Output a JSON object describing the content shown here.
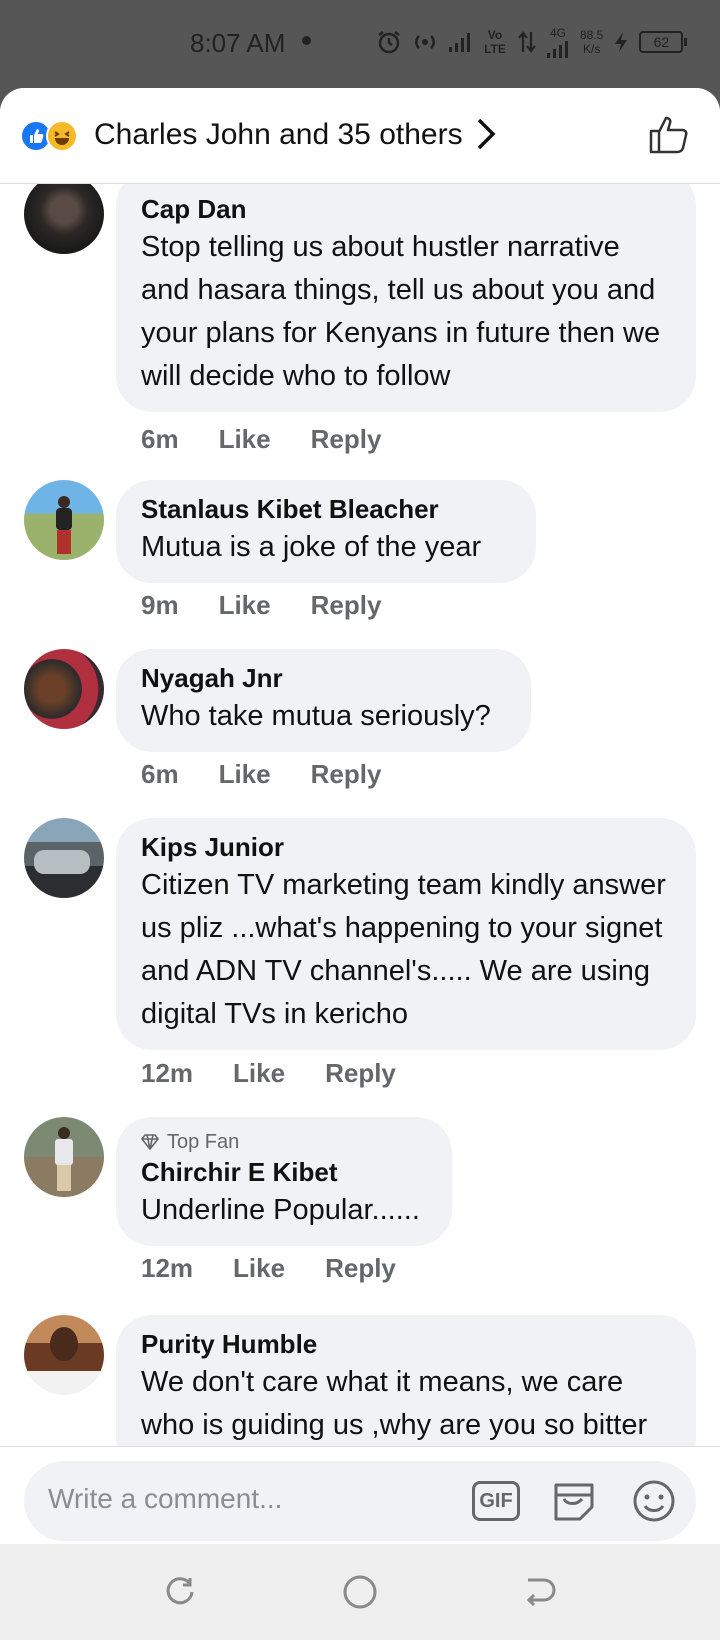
{
  "status": {
    "time": "8:07 AM",
    "speed_value": "88.5",
    "speed_unit": "K/s",
    "net": "4G",
    "volte": "Vo LTE",
    "battery": "62"
  },
  "header": {
    "reactors": "Charles John and 35 others"
  },
  "comments": [
    {
      "author": "Cap Dan",
      "text": "Stop telling us about hustler narrative and hasara things, tell us about you and your plans for Kenyans in future then we will decide who to follow",
      "time": "6m",
      "like": "Like",
      "reply": "Reply"
    },
    {
      "author": "Stanlaus Kibet Bleacher",
      "text": "Mutua is a joke of the year",
      "time": "9m",
      "like": "Like",
      "reply": "Reply"
    },
    {
      "author": "Nyagah Jnr",
      "text": "Who take mutua seriously?",
      "time": "6m",
      "like": "Like",
      "reply": "Reply"
    },
    {
      "author": "Kips Junior",
      "text": "Citizen TV marketing team kindly answer us pliz ...what's happening to your signet and ADN TV channel's..... We are using digital TVs in kericho",
      "time": "12m",
      "like": "Like",
      "reply": "Reply"
    },
    {
      "badge": "Top Fan",
      "author": "Chirchir E Kibet",
      "text": "Underline Popular......",
      "time": "12m",
      "like": "Like",
      "reply": "Reply"
    },
    {
      "author": "Purity Humble",
      "text": "We don't care what it means, we care who is guiding us ,why are you so bitter"
    }
  ],
  "composer": {
    "placeholder": "Write a comment...",
    "gif_label": "GIF"
  }
}
